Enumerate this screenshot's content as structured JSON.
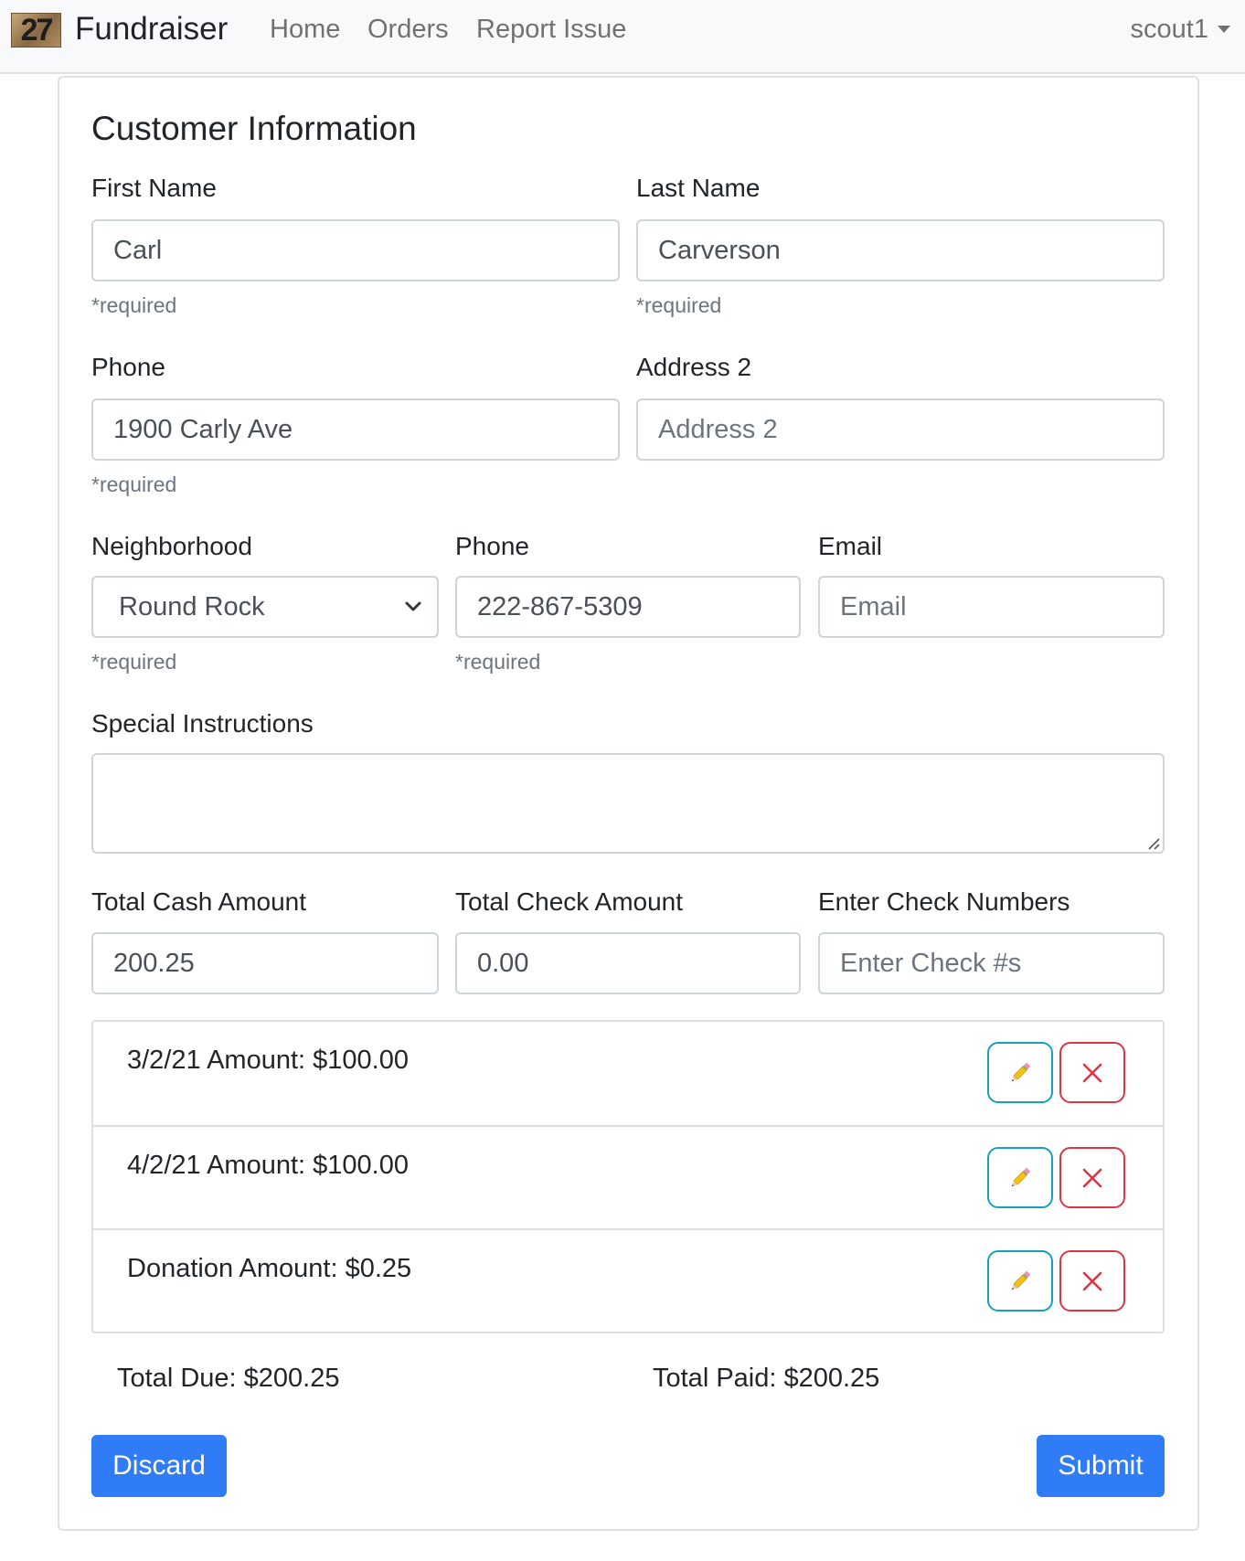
{
  "nav": {
    "logo_text": "27",
    "brand": "Fundraiser",
    "links": [
      "Home",
      "Orders",
      "Report Issue"
    ],
    "user": "scout1"
  },
  "form": {
    "title": "Customer Information",
    "first_name": {
      "label": "First Name",
      "value": "Carl",
      "help": "*required"
    },
    "last_name": {
      "label": "Last Name",
      "value": "Carverson",
      "help": "*required"
    },
    "address1": {
      "label": "Phone",
      "value": "1900 Carly Ave",
      "help": "*required"
    },
    "address2": {
      "label": "Address 2",
      "value": "",
      "placeholder": "Address 2"
    },
    "neighborhood": {
      "label": "Neighborhood",
      "selected": "Round Rock",
      "help": "*required"
    },
    "phone": {
      "label": "Phone",
      "value": "222-867-5309",
      "help": "*required"
    },
    "email": {
      "label": "Email",
      "value": "",
      "placeholder": "Email"
    },
    "special_instructions": {
      "label": "Special Instructions",
      "value": ""
    },
    "cash": {
      "label": "Total Cash Amount",
      "value": "200.25"
    },
    "check": {
      "label": "Total Check Amount",
      "value": "0.00"
    },
    "check_numbers": {
      "label": "Enter Check Numbers",
      "value": "",
      "placeholder": "Enter Check #s"
    }
  },
  "line_items": [
    {
      "text": "3/2/21 Amount: $100.00"
    },
    {
      "text": "4/2/21 Amount: $100.00"
    },
    {
      "text": "Donation Amount: $0.25"
    }
  ],
  "totals": {
    "due": "Total Due: $200.25",
    "paid": "Total Paid: $200.25"
  },
  "actions": {
    "discard": "Discard",
    "submit": "Submit"
  },
  "icons": {
    "edit": "pencil-icon",
    "delete": "x-icon"
  },
  "colors": {
    "primary": "#2f7cf6",
    "edit_border": "#17a2b8",
    "delete_border": "#dc3545"
  }
}
